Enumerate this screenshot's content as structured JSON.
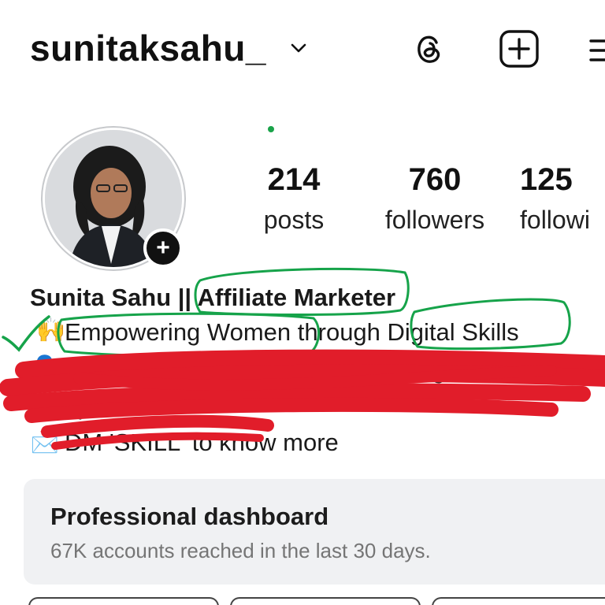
{
  "header": {
    "username": "sunitaksahu_",
    "icons": [
      "chevron-down-icon",
      "threads-icon",
      "add-post-icon",
      "menu-icon"
    ]
  },
  "stats": {
    "posts": {
      "value": "214",
      "label": "posts"
    },
    "followers": {
      "value": "760",
      "label": "followers"
    },
    "following": {
      "value": "125",
      "label": "followi"
    }
  },
  "bio": {
    "name": "Sunita Sahu || Affiliate Marketer",
    "line1": "Empowering Women through Digital Skills",
    "line2": "Helped 50+ Housewives & Moms gain Financi",
    "line3": "Independ",
    "line4": "DM 'SKILL' to know more"
  },
  "dashboard": {
    "title": "Professional dashboard",
    "subtitle": "67K accounts reached in the last 30 days."
  },
  "colors": {
    "annotation_green": "#16a34a",
    "scribble_red": "#e11d2a",
    "dashboard_bg": "#f0f1f3"
  }
}
